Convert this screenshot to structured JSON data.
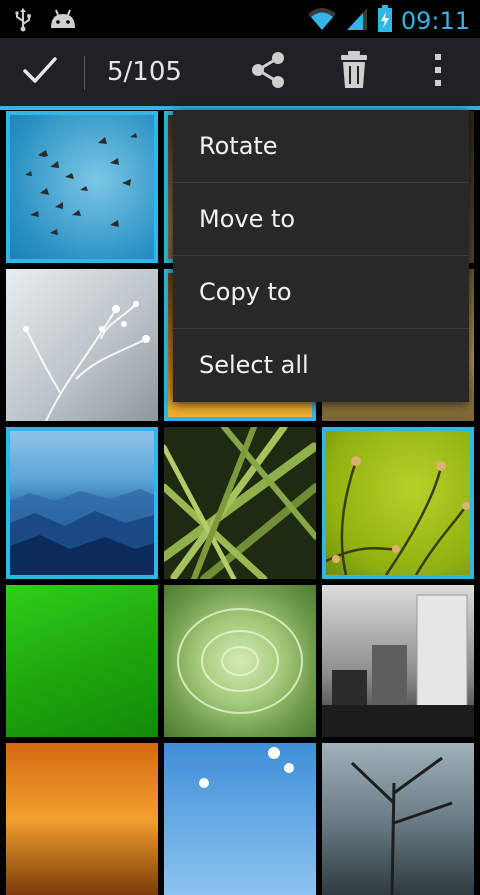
{
  "status_bar": {
    "time": "09:11",
    "icons": [
      "usb-icon",
      "android-debug-icon",
      "wifi-icon",
      "signal-icon",
      "battery-charging-icon"
    ],
    "accent": "#33b5e5"
  },
  "action_bar": {
    "selection_count": "5/105",
    "buttons": [
      "done-check-icon",
      "share-icon",
      "delete-icon",
      "overflow-menu-icon"
    ],
    "accent": "#33b5e5"
  },
  "menu": {
    "items": [
      "Rotate",
      "Move to",
      "Copy to",
      "Select all"
    ]
  },
  "grid": {
    "tiles": [
      {
        "name": "birds-in-sky-photo",
        "selected": true
      },
      {
        "name": "warm-landscape-photo",
        "selected": true
      },
      {
        "name": "brown-photo",
        "selected": false
      },
      {
        "name": "frosted-plant-photo",
        "selected": false
      },
      {
        "name": "orange-photo",
        "selected": true
      },
      {
        "name": "golden-water-photo",
        "selected": false
      },
      {
        "name": "blue-mountains-photo",
        "selected": true
      },
      {
        "name": "grass-blades-photo",
        "selected": false
      },
      {
        "name": "green-stems-photo",
        "selected": true
      },
      {
        "name": "green-leaf-photo",
        "selected": false
      },
      {
        "name": "succulent-photo",
        "selected": false
      },
      {
        "name": "city-buildings-photo",
        "selected": false
      },
      {
        "name": "sunset-photo",
        "selected": false
      },
      {
        "name": "blossom-sky-photo",
        "selected": false
      },
      {
        "name": "tree-water-photo",
        "selected": false
      }
    ]
  }
}
